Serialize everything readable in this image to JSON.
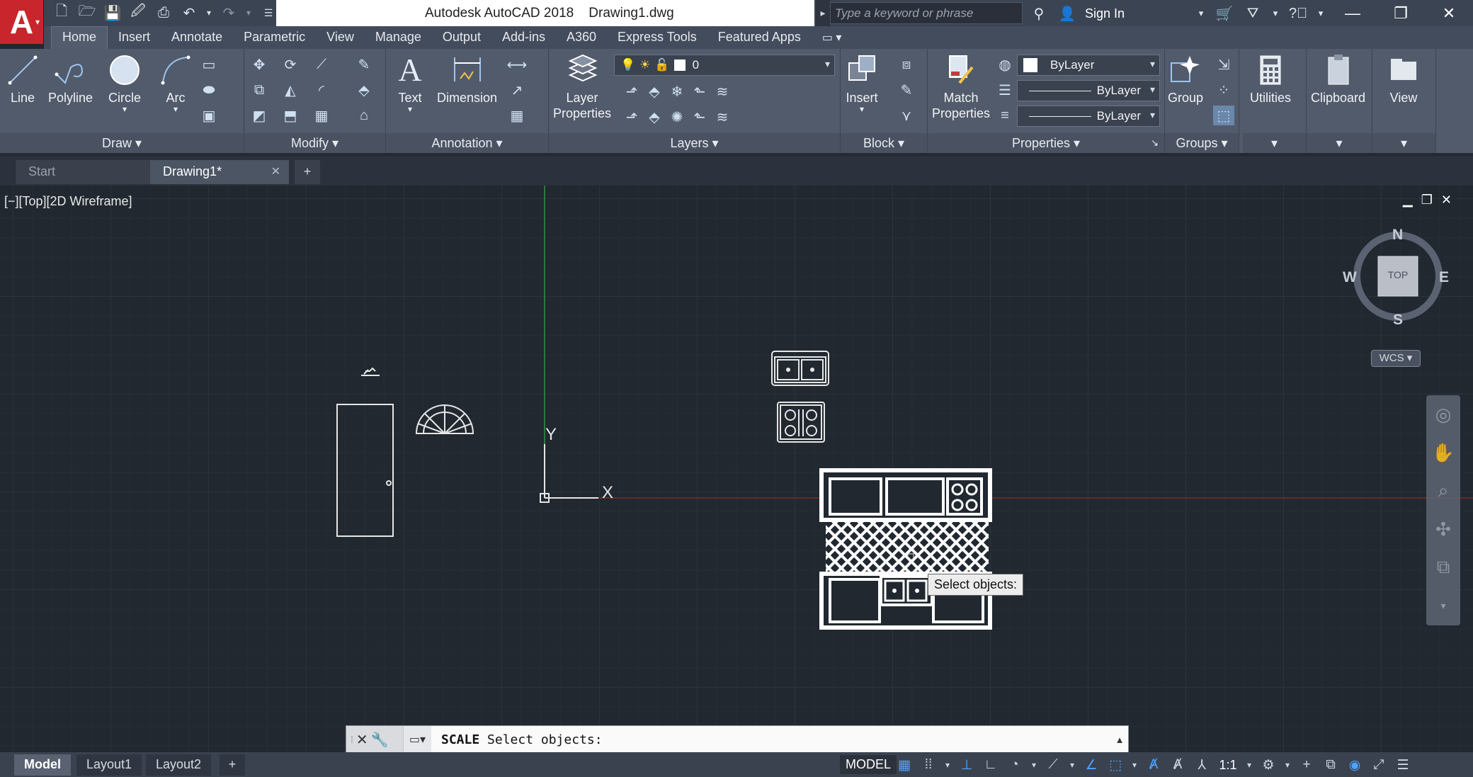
{
  "app": {
    "logo_letter": "A",
    "window_title": "Autodesk AutoCAD 2018    Drawing1.dwg",
    "search_placeholder": "Type a keyword or phrase",
    "sign_in": "Sign In"
  },
  "ribbon_tabs": [
    "Home",
    "Insert",
    "Annotate",
    "Parametric",
    "View",
    "Manage",
    "Output",
    "Add-ins",
    "A360",
    "Express Tools",
    "Featured Apps"
  ],
  "ribbon": {
    "draw": {
      "title": "Draw",
      "line": "Line",
      "polyline": "Polyline",
      "circle": "Circle",
      "arc": "Arc"
    },
    "modify": {
      "title": "Modify"
    },
    "annotation": {
      "title": "Annotation",
      "text": "Text",
      "dimension": "Dimension"
    },
    "layers": {
      "title": "Layers",
      "layer_properties_1": "Layer",
      "layer_properties_2": "Properties",
      "current_layer": "0"
    },
    "block": {
      "title": "Block",
      "insert": "Insert"
    },
    "properties": {
      "title": "Properties",
      "match_1": "Match",
      "match_2": "Properties",
      "color": "ByLayer",
      "linetype": "ByLayer",
      "lineweight": "ByLayer"
    },
    "groups": {
      "title": "Groups",
      "group": "Group"
    },
    "utilities": {
      "label": "Utilities"
    },
    "clipboard": {
      "label": "Clipboard"
    },
    "view": {
      "label": "View"
    }
  },
  "file_tabs": {
    "start": "Start",
    "drawing": "Drawing1*"
  },
  "viewport": {
    "label": "[−][Top][2D Wireframe]",
    "axis_y": "Y",
    "axis_x": "X",
    "tooltip": "Select objects:"
  },
  "viewcube": {
    "north": "N",
    "south": "S",
    "east": "E",
    "west": "W",
    "face": "TOP",
    "wcs": "WCS"
  },
  "command_line": {
    "command": "SCALE",
    "prompt": " Select objects:"
  },
  "status": {
    "layouts": [
      "Model",
      "Layout1",
      "Layout2"
    ],
    "model": "MODEL",
    "scale": "1:1"
  },
  "colors": {
    "logo_red": "#c8262c",
    "canvas": "#212830",
    "ribbon": "#525b6b",
    "accent_blue": "#4fa3ff"
  }
}
